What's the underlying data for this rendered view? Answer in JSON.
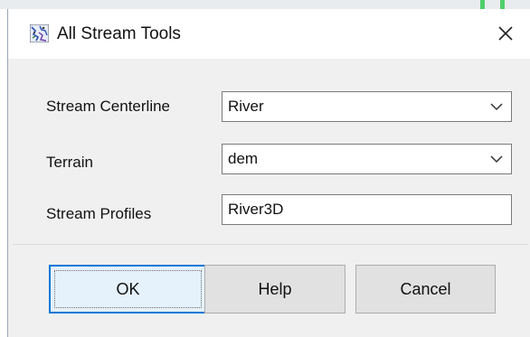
{
  "window": {
    "title": "All Stream Tools",
    "icon": "all-stream-tools-app-icon",
    "close_icon": "close-icon"
  },
  "form": {
    "rows": [
      {
        "label": "Stream Centerline",
        "value": "River",
        "type": "dropdown"
      },
      {
        "label": "Terrain",
        "value": "dem",
        "type": "dropdown"
      },
      {
        "label": "Stream Profiles",
        "value": "River3D",
        "type": "text"
      }
    ]
  },
  "buttons": {
    "ok": "OK",
    "help": "Help",
    "cancel": "Cancel"
  },
  "colors": {
    "client_background": "#f0f0f0",
    "default_button_border": "#0078d7",
    "button_face": "#e1e1e1"
  }
}
